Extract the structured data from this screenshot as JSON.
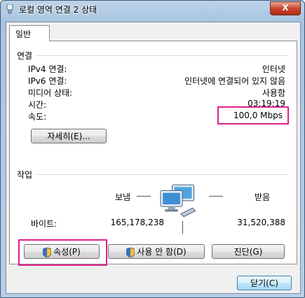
{
  "window": {
    "title": "로컬 영역 연결 2 상태",
    "close_label": "X"
  },
  "tabs": [
    {
      "label": "일반"
    }
  ],
  "connection": {
    "group_label": "연결",
    "rows": [
      {
        "label": "IPv4 연결:",
        "value": "인터넷"
      },
      {
        "label": "IPv6 연결:",
        "value": "인터넷에 연결되어 있지 않음"
      },
      {
        "label": "미디어 상태:",
        "value": "사용함"
      },
      {
        "label": "시간:",
        "value": "03:19:19"
      },
      {
        "label": "속도:",
        "value": "100,0 Mbps"
      }
    ],
    "details_button": "자세히(E)..."
  },
  "activity": {
    "group_label": "작업",
    "sent_label": "보냄",
    "received_label": "받음",
    "bytes_label": "바이트:",
    "bytes_sent": "165,178,238",
    "bytes_received": "31,520,388"
  },
  "buttons": {
    "properties": "속성(P)",
    "disable": "사용 안 함(D)",
    "diagnose": "진단(G)",
    "close": "닫기(C)"
  },
  "icons": {
    "window_icon": "network-adapter-icon",
    "network_icon": "network-computers-icon",
    "shield_icon": "uac-shield-icon"
  },
  "colors": {
    "highlight": "#e0218a",
    "titlebar": "#a9c4e0"
  }
}
